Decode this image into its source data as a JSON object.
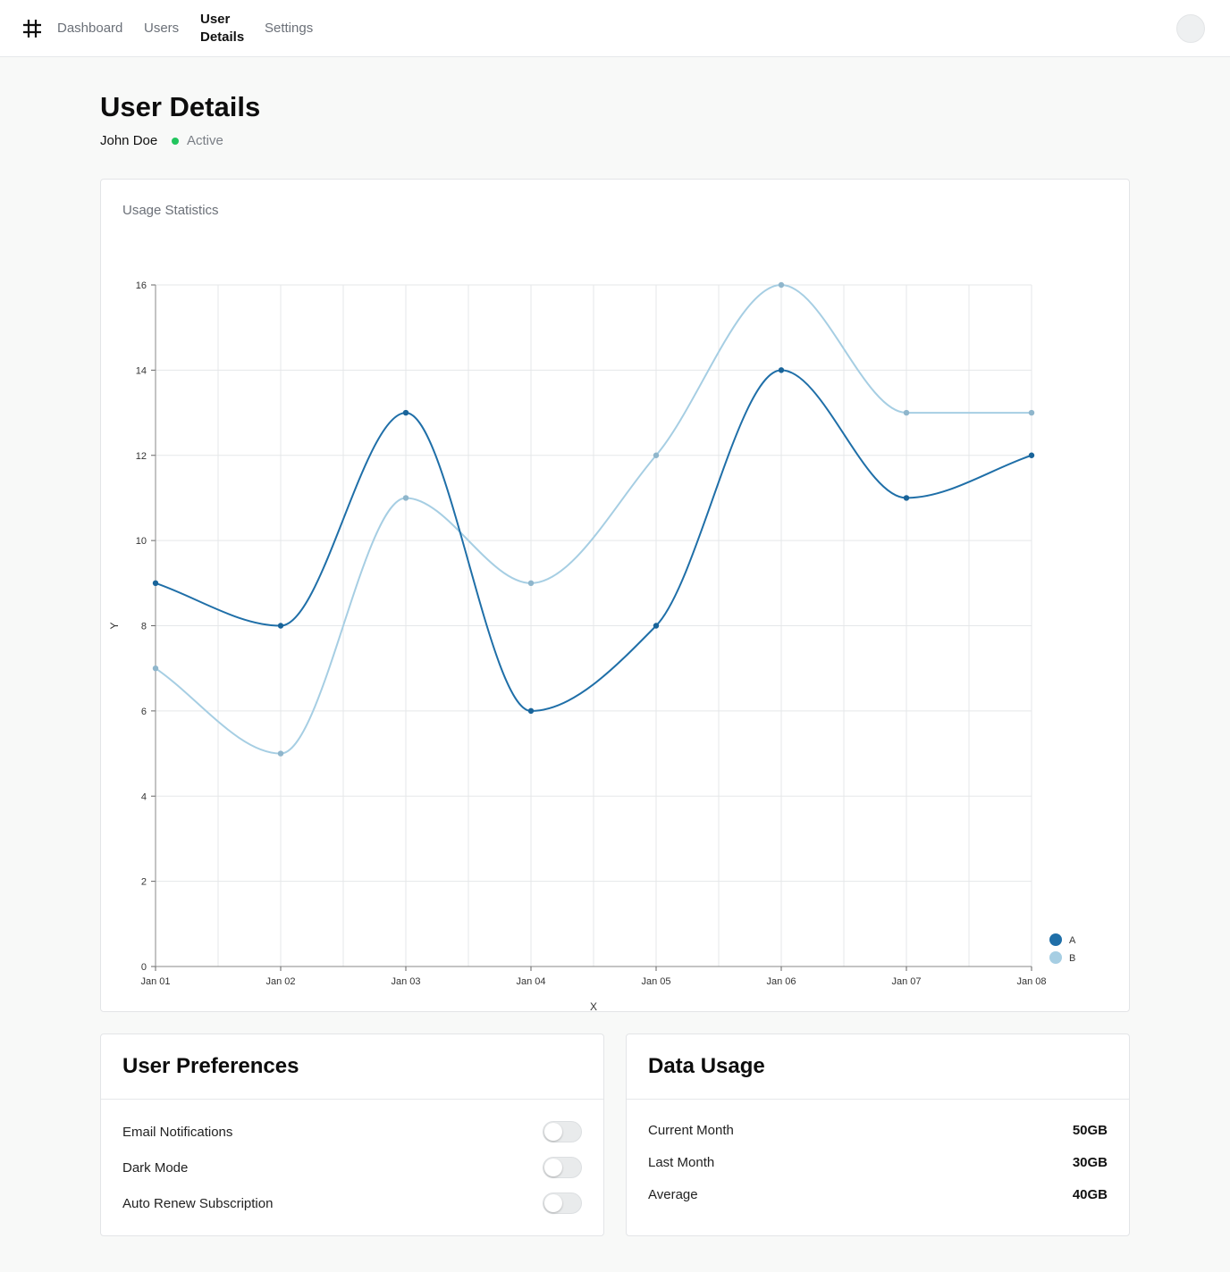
{
  "nav": {
    "items": [
      {
        "label": "Dashboard",
        "active": false
      },
      {
        "label": "Users",
        "active": false
      },
      {
        "label": "User\nDetails",
        "active": true
      },
      {
        "label": "Settings",
        "active": false
      }
    ]
  },
  "header": {
    "title": "User Details",
    "user_name": "John Doe",
    "status": "Active",
    "status_color": "#22c55e"
  },
  "chart_card": {
    "title": "Usage Statistics"
  },
  "chart_data": {
    "type": "line",
    "x": [
      "Jan 01",
      "Jan 02",
      "Jan 03",
      "Jan 04",
      "Jan 05",
      "Jan 06",
      "Jan 07",
      "Jan 08"
    ],
    "series": [
      {
        "name": "A",
        "color": "#1f6fa8",
        "values": [
          9,
          8,
          13,
          6,
          8,
          14,
          11,
          12
        ]
      },
      {
        "name": "B",
        "color": "#a6cee3",
        "values": [
          7,
          5,
          11,
          9,
          12,
          16,
          13,
          13
        ]
      }
    ],
    "xlabel": "X",
    "ylabel": "Y",
    "ylim": [
      0,
      16
    ],
    "yticks": [
      0,
      2,
      4,
      6,
      8,
      10,
      12,
      14,
      16
    ],
    "grid": true,
    "legend": "bottom-right",
    "curve": "smooth"
  },
  "preferences": {
    "title": "User Preferences",
    "items": [
      {
        "label": "Email Notifications",
        "enabled": false
      },
      {
        "label": "Dark Mode",
        "enabled": false
      },
      {
        "label": "Auto Renew Subscription",
        "enabled": false
      }
    ]
  },
  "data_usage": {
    "title": "Data Usage",
    "rows": [
      {
        "label": "Current Month",
        "value": "50GB"
      },
      {
        "label": "Last Month",
        "value": "30GB"
      },
      {
        "label": "Average",
        "value": "40GB"
      }
    ]
  }
}
